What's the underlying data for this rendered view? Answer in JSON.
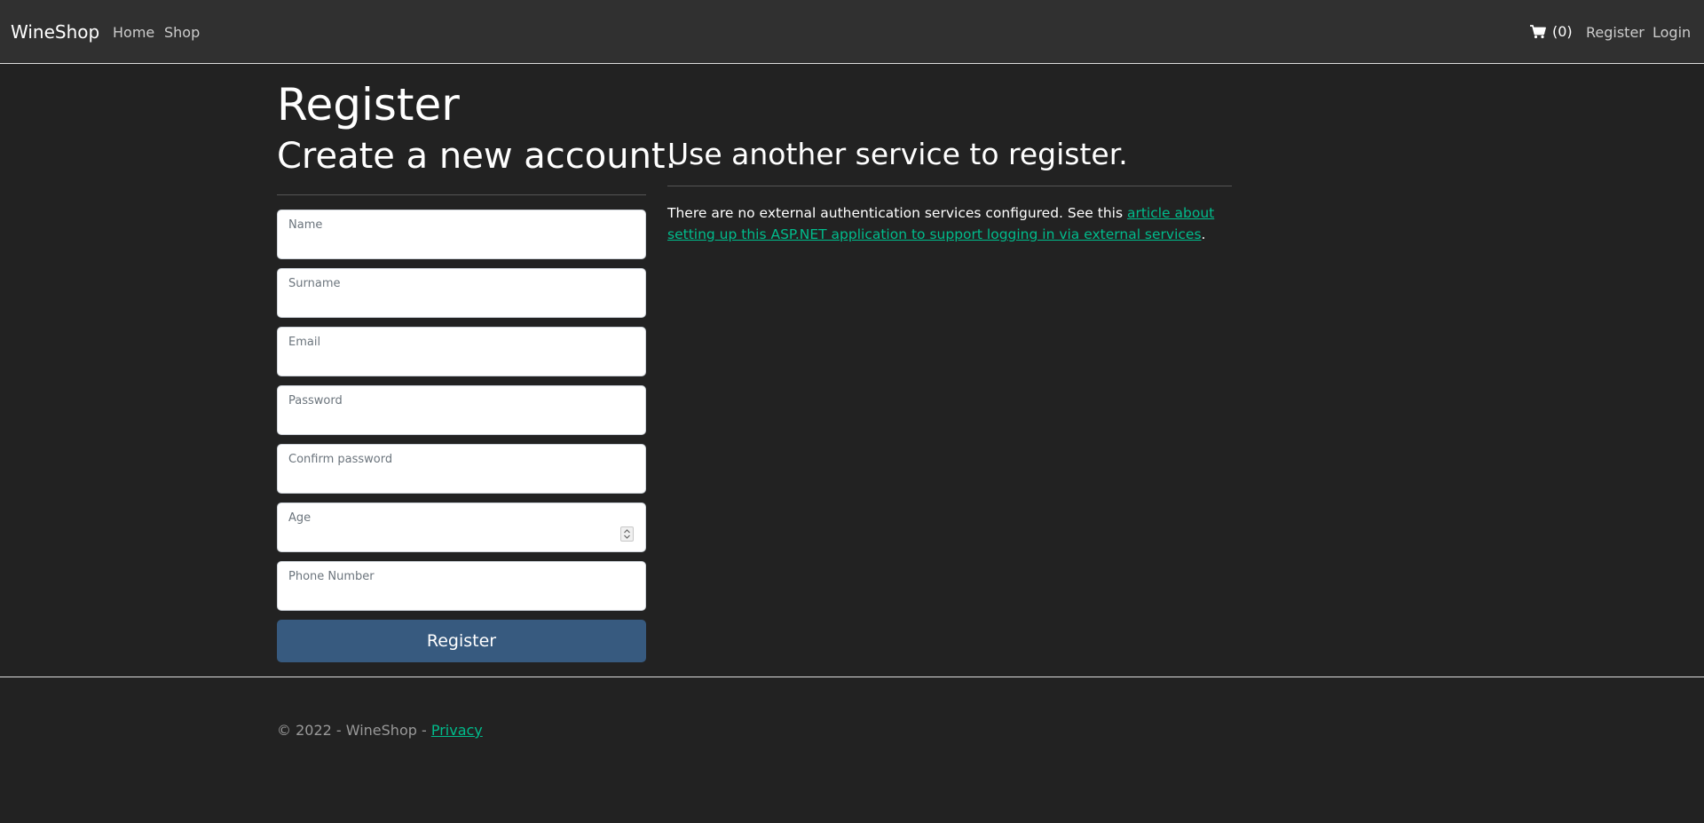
{
  "navbar": {
    "brand": "WineShop",
    "links": [
      "Home",
      "Shop"
    ],
    "cart_count": "(0)",
    "register": "Register",
    "login": "Login"
  },
  "page": {
    "title": "Register",
    "subtitle": "Create a new account."
  },
  "form": {
    "fields": [
      {
        "label": "Name",
        "value": ""
      },
      {
        "label": "Surname",
        "value": ""
      },
      {
        "label": "Email",
        "value": ""
      },
      {
        "label": "Password",
        "value": ""
      },
      {
        "label": "Confirm password",
        "value": ""
      },
      {
        "label": "Age",
        "value": ""
      },
      {
        "label": "Phone Number",
        "value": ""
      }
    ],
    "submit": "Register"
  },
  "external": {
    "title": "Use another service to register.",
    "text": "There are no external authentication services configured. See this ",
    "link": "article about setting up this ASP.NET application to support logging in via external services",
    "suffix": "."
  },
  "footer": {
    "text": "© 2022 - WineShop - ",
    "privacy": "Privacy"
  },
  "icons": {
    "cart": "cart-icon",
    "spinner": "spinner-icon"
  },
  "colors": {
    "background": "#222222",
    "navbar": "#303030",
    "primary_button": "#375a7f",
    "link": "#00bc8c",
    "footer_text": "#999999"
  }
}
